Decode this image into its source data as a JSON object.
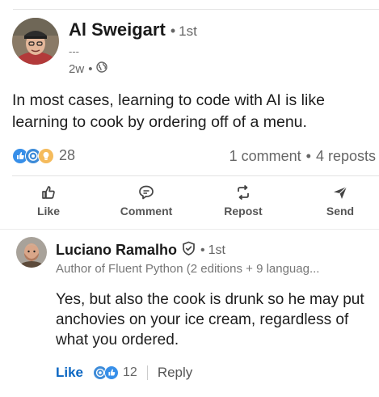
{
  "post": {
    "author_name": "Al Sweigart",
    "degree": "1st",
    "degree_separator": "•",
    "headline": "---",
    "time": "2w",
    "time_separator": "•",
    "visibility_icon": "globe-icon",
    "text": "In most cases, learning to code with AI is like learning to cook by ordering off of a menu.",
    "reactions": {
      "icons": [
        "like-reaction-icon",
        "support-reaction-icon",
        "insightful-reaction-icon"
      ],
      "count": "28"
    },
    "comments_label": "1 comment",
    "stats_separator": "•",
    "reposts_label": "4 reposts"
  },
  "actions": [
    {
      "label": "Like",
      "icon": "thumbs-up-icon"
    },
    {
      "label": "Comment",
      "icon": "comment-bubble-icon"
    },
    {
      "label": "Repost",
      "icon": "repost-arrows-icon"
    },
    {
      "label": "Send",
      "icon": "send-paper-plane-icon"
    }
  ],
  "comment": {
    "author_name": "Luciano Ramalho",
    "verified_icon": "shield-check-icon",
    "degree_separator": "•",
    "degree": "1st",
    "headline": "Author of Fluent Python (2 editions + 9 languag...",
    "text": "Yes, but also the cook is drunk so he may put anchovies on your ice cream, regardless of what you ordered.",
    "like_label": "Like",
    "reaction_icons": [
      "support-reaction-icon",
      "like-reaction-icon"
    ],
    "reaction_count": "12",
    "reply_label": "Reply"
  },
  "colors": {
    "like_blue": "#0a66c2",
    "support_purple": "#3d8bd8",
    "insightful_yellow": "#f5bb5c",
    "text_primary": "#1d1d1d",
    "text_secondary": "#666666"
  }
}
